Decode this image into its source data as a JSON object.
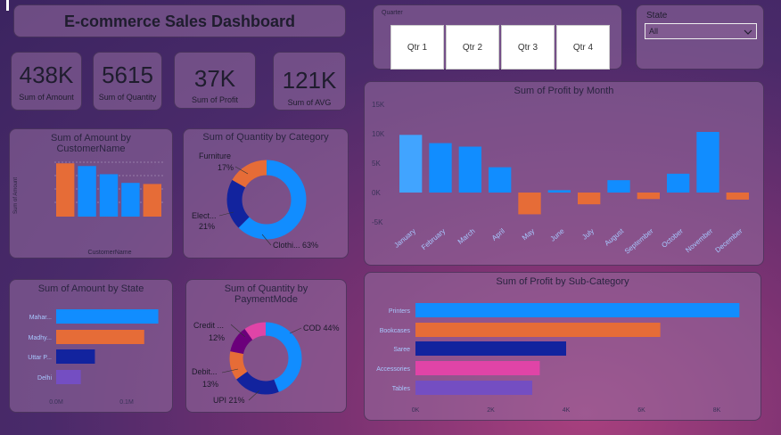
{
  "title": "E-commerce Sales Dashboard",
  "kpis": [
    {
      "value": "438K",
      "label": "Sum of Amount"
    },
    {
      "value": "5615",
      "label": "Sum of Quantity"
    },
    {
      "value": "37K",
      "label": "Sum of Profit"
    },
    {
      "value": "121K",
      "label": "Sum of AVG"
    }
  ],
  "quarter_slicer": {
    "label": "Quarter",
    "options": [
      "Qtr 1",
      "Qtr 2",
      "Qtr 3",
      "Qtr 4"
    ]
  },
  "state_slicer": {
    "label": "State",
    "selected": "All"
  },
  "colors": {
    "blue": "#118dff",
    "orange": "#e66c37",
    "navy": "#12239e",
    "pink": "#e044a7",
    "purple": "#744ec2",
    "lightblue": "#41a4ff",
    "darkpurple": "#6b007b"
  },
  "chart_data": [
    {
      "id": "amount_by_customer",
      "type": "bar",
      "title": "Sum of Amount by CustomerName",
      "xlabel": "CustomerName",
      "ylabel": "Sum of Amount",
      "values": [
        9.8,
        9.3,
        7.8,
        6.2,
        6.0
      ],
      "colors": [
        "#e66c37",
        "#118dff",
        "#118dff",
        "#118dff",
        "#e66c37"
      ]
    },
    {
      "id": "qty_by_category",
      "type": "pie",
      "title": "Sum of Quantity by Category",
      "slices": [
        {
          "label": "Clothi...",
          "pct_label": "63%",
          "value": 63,
          "color": "#118dff"
        },
        {
          "label": "Elect...",
          "pct_label": "21%",
          "value": 21,
          "color": "#12239e"
        },
        {
          "label": "Furniture",
          "pct_label": "17%",
          "value": 17,
          "color": "#e66c37"
        }
      ]
    },
    {
      "id": "profit_by_month",
      "type": "bar",
      "title": "Sum of Profit by Month",
      "categories": [
        "January",
        "February",
        "March",
        "April",
        "May",
        "June",
        "July",
        "August",
        "September",
        "October",
        "November",
        "December"
      ],
      "values": [
        9800,
        8400,
        7800,
        4300,
        -3700,
        400,
        -2000,
        2100,
        -1100,
        3200,
        10300,
        -1200
      ],
      "y_ticks": [
        "15K",
        "10K",
        "5K",
        "0K",
        "-5K"
      ],
      "ylim": [
        -5000,
        15000
      ]
    },
    {
      "id": "amount_by_state",
      "type": "bar",
      "title": "Sum of Amount by State",
      "categories": [
        "Mahar...",
        "Madhy...",
        "Uttar P...",
        "Delhi"
      ],
      "values": [
        0.145,
        0.125,
        0.055,
        0.035
      ],
      "colors": [
        "#118dff",
        "#e66c37",
        "#12239e",
        "#744ec2"
      ],
      "x_ticks": [
        "0.0M",
        "0.1M"
      ],
      "xlim": [
        0,
        0.1
      ]
    },
    {
      "id": "qty_by_payment",
      "type": "pie",
      "title": "Sum of Quantity by PaymentMode",
      "slices": [
        {
          "label": "COD",
          "pct_label": "44%",
          "value": 44,
          "color": "#118dff"
        },
        {
          "label": "UPI",
          "pct_label": "21%",
          "value": 21,
          "color": "#12239e"
        },
        {
          "label": "Debit...",
          "pct_label": "13%",
          "value": 13,
          "color": "#e66c37"
        },
        {
          "label": "Credit ...",
          "pct_label": "12%",
          "value": 12,
          "color": "#6b007b"
        },
        {
          "label": "",
          "pct_label": "",
          "value": 10,
          "color": "#e044a7"
        }
      ]
    },
    {
      "id": "profit_by_subcategory",
      "type": "bar",
      "title": "Sum of Profit by Sub-Category",
      "categories": [
        "Printers",
        "Bookcases",
        "Saree",
        "Accessories",
        "Tables"
      ],
      "values": [
        8600,
        6500,
        4000,
        3300,
        3100
      ],
      "colors": [
        "#118dff",
        "#e66c37",
        "#12239e",
        "#e044a7",
        "#744ec2"
      ],
      "x_ticks": [
        "0K",
        "2K",
        "4K",
        "6K",
        "8K"
      ],
      "xlim": [
        0,
        8000
      ]
    }
  ]
}
